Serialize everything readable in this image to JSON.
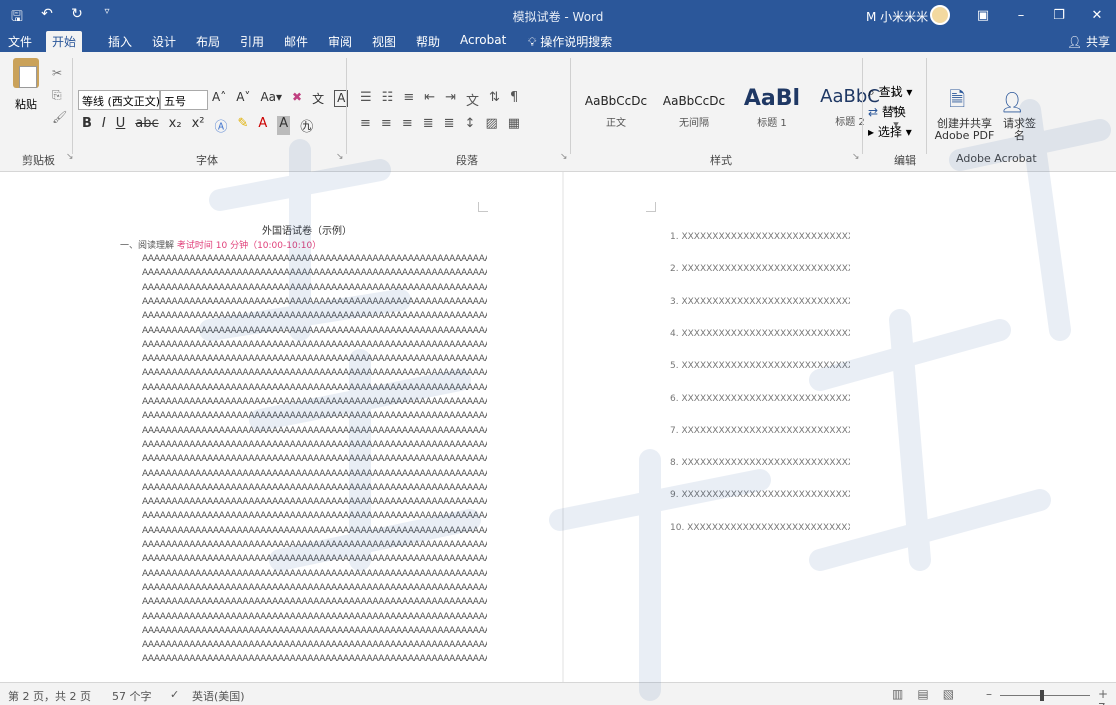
{
  "titlebar": {
    "doc_title": "模拟试卷 - Word",
    "user": "M 小米米米",
    "quick_access": [
      "save",
      "undo",
      "redo"
    ]
  },
  "menubar": {
    "tabs": [
      "文件",
      "开始",
      "插入",
      "设计",
      "布局",
      "引用",
      "邮件",
      "审阅",
      "视图",
      "帮助",
      "Acrobat"
    ],
    "active_tab": "开始",
    "tellme": "操作说明搜索",
    "share": "共享"
  },
  "ribbon": {
    "paste_label": "粘贴",
    "font_name": "等线 (西文正文)",
    "font_size": "五号",
    "styles": [
      {
        "preview": "AaBbCcDc",
        "label": "正文"
      },
      {
        "preview": "AaBbCcDc",
        "label": "无间隔"
      },
      {
        "preview": "AaBl",
        "label": "标题 1"
      },
      {
        "preview": "AaBbC",
        "label": "标题 2"
      }
    ],
    "find": "查找",
    "replace": "替换",
    "select": "选择",
    "pdf_create": "创建并共享 Adobe PDF",
    "pdf_sign": "请求签名",
    "groups": {
      "clipboard": "剪贴板",
      "font": "字体",
      "paragraph": "段落",
      "styles": "样式",
      "editing": "编辑",
      "acrobat": "Adobe Acrobat"
    }
  },
  "document": {
    "paper_title": "外国语试卷（示例）",
    "section_prefix": "一、阅读理解",
    "section_timing": "考试时间 10 分钟（10:00-10:10）",
    "filler_line": "AAAAAAAAAAAAAAAAAAAAAAAAAAAAAAAAAAAAAAAAAAAAAAAAAAAAAAAAAAAAAAAAAA",
    "filler_count": 29,
    "answers": [
      "1.  XXXXXXXXXXXXXXXXXXXXXXXXXXXXXXXX",
      "2.  XXXXXXXXXXXXXXXXXXXXXXXXXXXXXXXX",
      "3.  XXXXXXXXXXXXXXXXXXXXXXXXXXXXXXXX",
      "4.  XXXXXXXXXXXXXXXXXXXXXXXXXXXXXXXX",
      "5.  XXXXXXXXXXXXXXXXXXXXXXXXXXXXXXXX",
      "6.  XXXXXXXXXXXXXXXXXXXXXXXXXXXXXXXX",
      "7.  XXXXXXXXXXXXXXXXXXXXXXXXXXXXXXXX",
      "8.  XXXXXXXXXXXXXXXXXXXXXXXXXXXXXXXX",
      "9.  XXXXXXXXXXXXXXXXXXXXXXXXXXXXXXXX",
      "10.     XXXXXXXXXXXXXXXXXXXXXXXXXXXXX"
    ]
  },
  "statusbar": {
    "pages": "第 2 页，共 2 页",
    "words": "57 个字",
    "language": "英语(美国)",
    "zoom": "+ 7"
  },
  "watermark": "南京大学研招"
}
